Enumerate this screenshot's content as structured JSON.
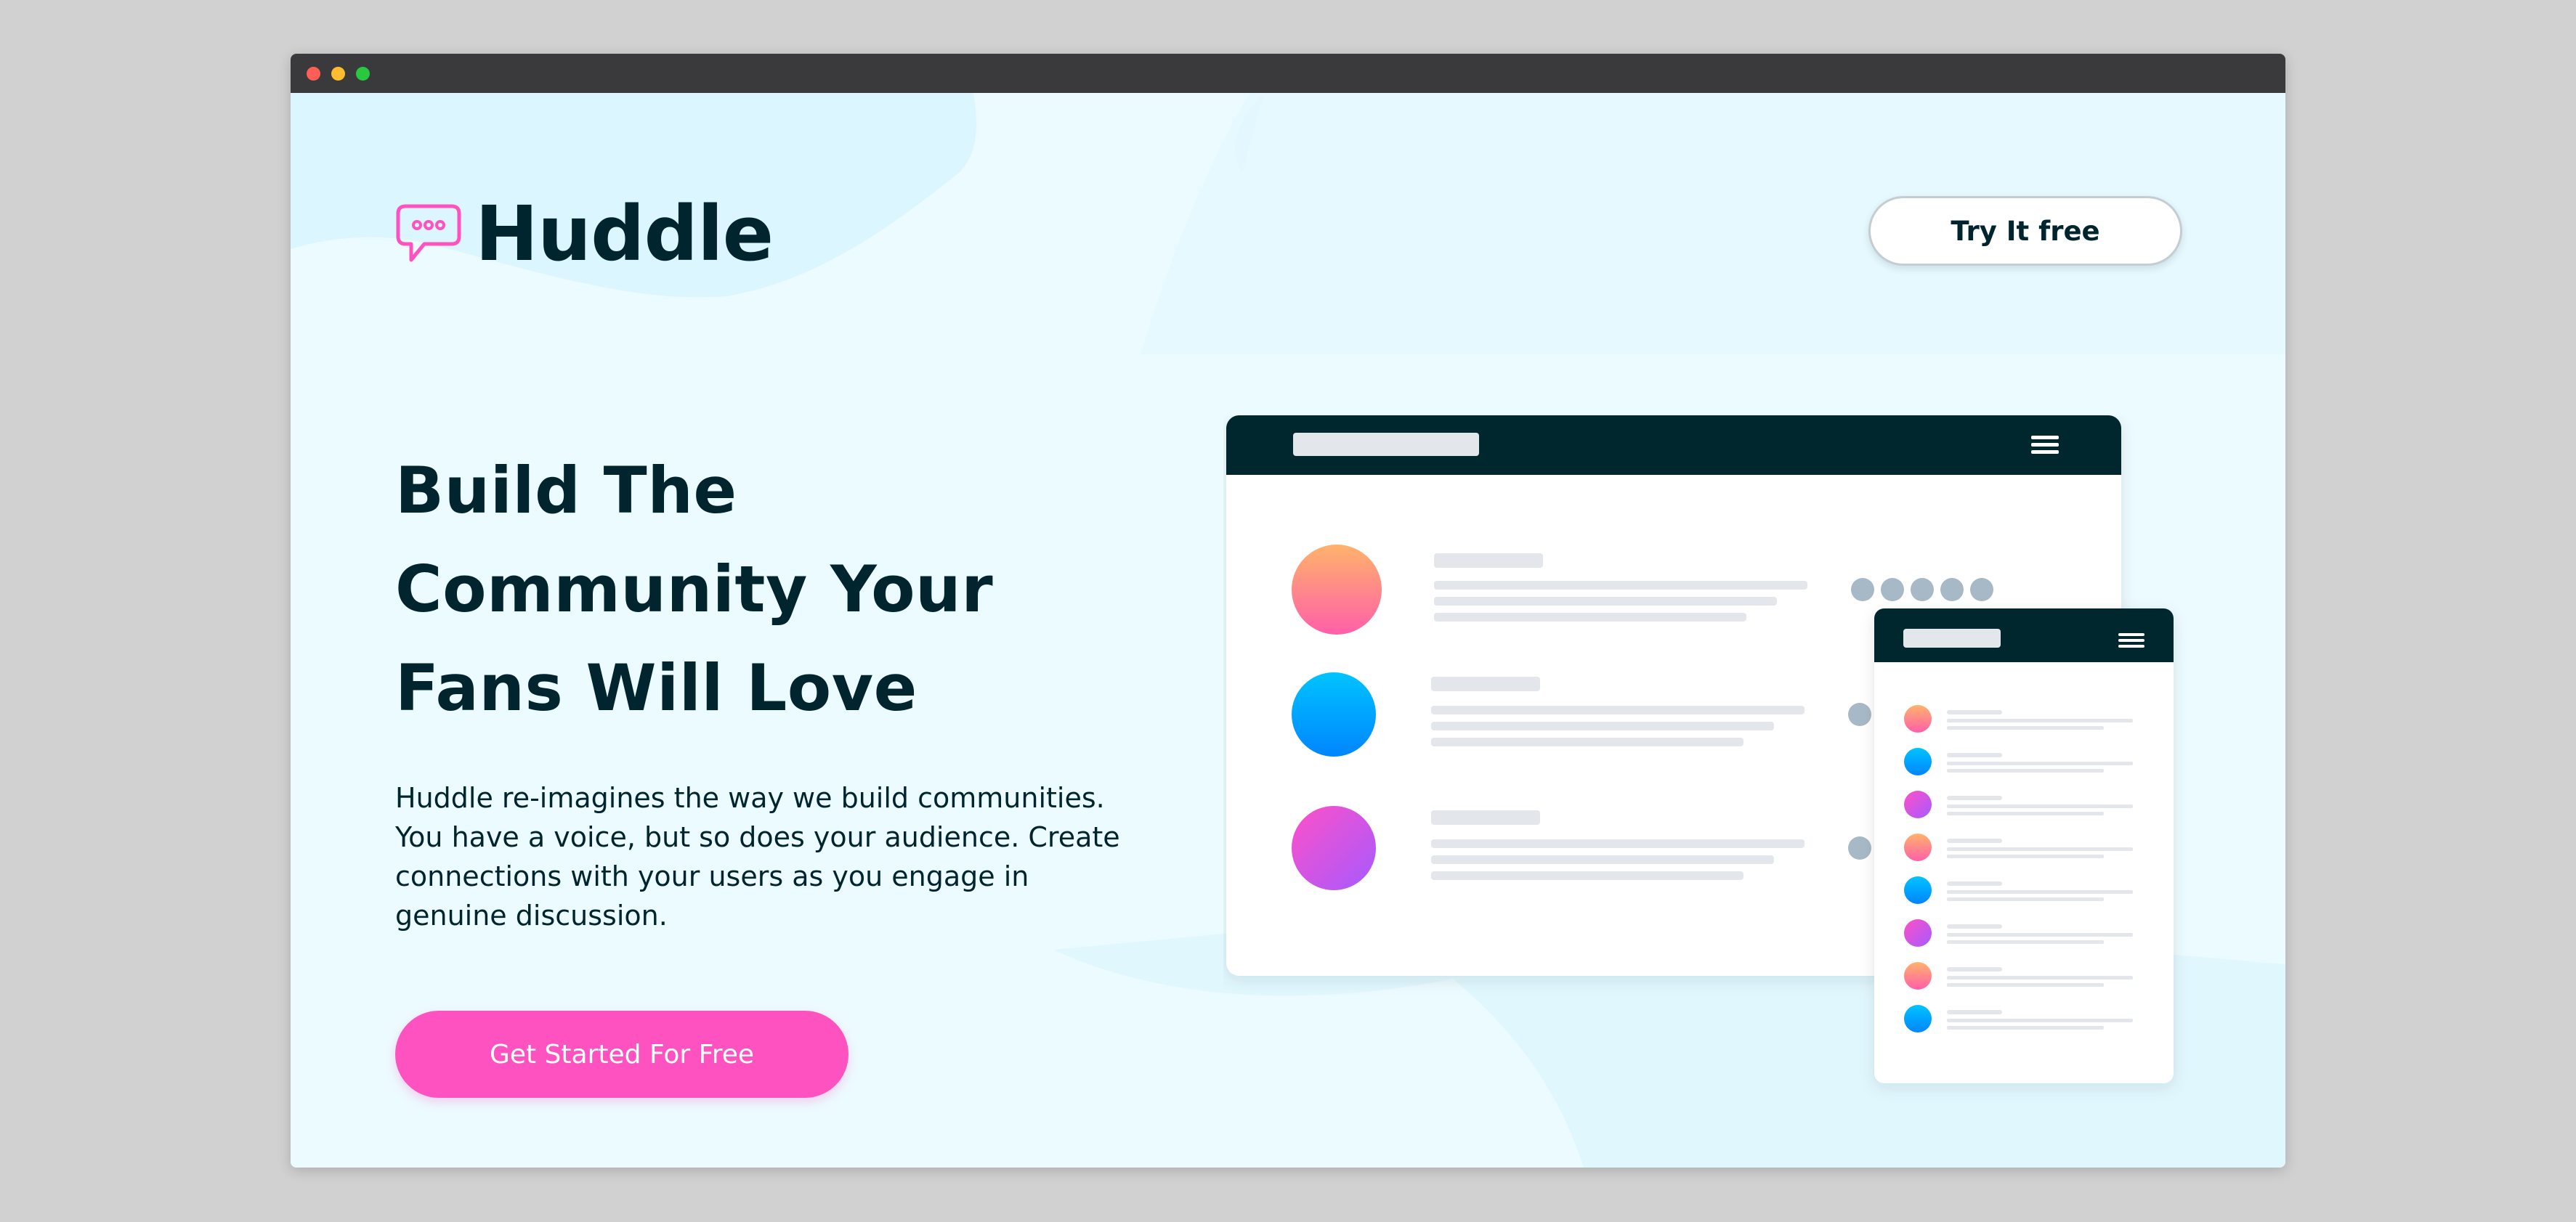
{
  "window": {
    "controls": [
      "close",
      "minimize",
      "zoom"
    ]
  },
  "brand": {
    "name": "Huddle",
    "icon": "chat-bubble-icon",
    "accent": "#ff52c1"
  },
  "header": {
    "try_button_label": "Try It free"
  },
  "hero": {
    "headline_lines": [
      "Build The",
      "Community Your",
      "Fans Will Love"
    ],
    "description_lines": [
      "Huddle re-imagines the way we build communities.",
      "You have a voice, but so does your audience. Create",
      "connections with your users as you engage in",
      "genuine discussion."
    ],
    "cta_label": "Get Started For Free"
  },
  "colors": {
    "background": "#ecfbff",
    "text_dark": "#00252e",
    "button_pink": "#ff52c1",
    "mockup_navbar": "#00252e"
  },
  "illustration": {
    "desktop_rows": [
      "orange-pink",
      "blue",
      "magenta-purple"
    ],
    "mobile_rows": [
      "orange-pink",
      "blue",
      "magenta-purple",
      "orange-pink",
      "blue",
      "magenta-purple",
      "orange-pink",
      "blue"
    ],
    "menu_icon": "hamburger-icon"
  }
}
